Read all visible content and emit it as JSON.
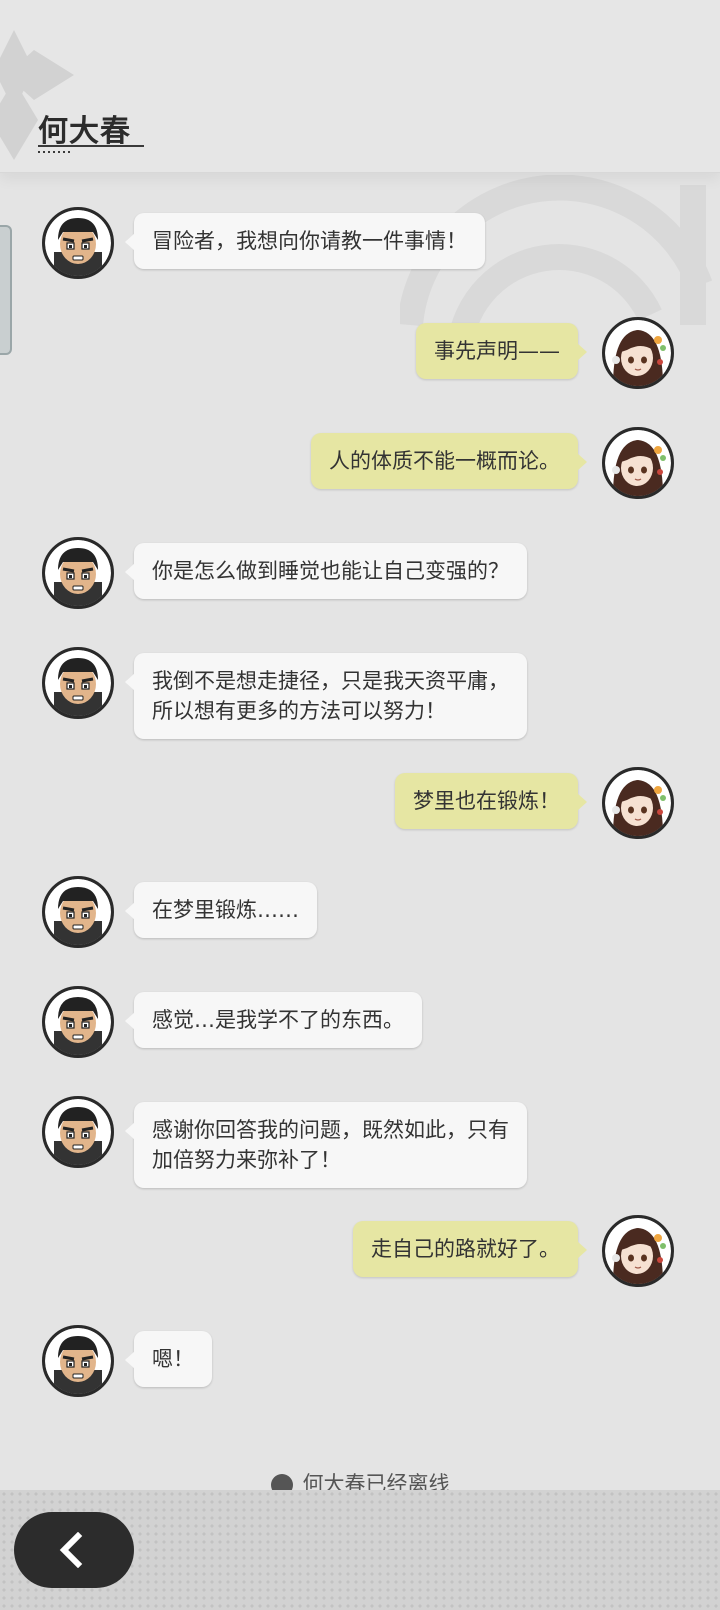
{
  "header": {
    "title": "何大春"
  },
  "messages": [
    {
      "speaker": "npc",
      "text": "冒险者，我想向你请教一件事情！"
    },
    {
      "speaker": "player",
      "text": "事先声明——"
    },
    {
      "speaker": "player",
      "text": "人的体质不能一概而论。"
    },
    {
      "speaker": "npc",
      "text": "你是怎么做到睡觉也能让自己变强的？"
    },
    {
      "speaker": "npc",
      "text": "我倒不是想走捷径，只是我天资平庸，\n所以想有更多的方法可以努力！"
    },
    {
      "speaker": "player",
      "text": "梦里也在锻炼！"
    },
    {
      "speaker": "npc",
      "text": "在梦里锻炼……"
    },
    {
      "speaker": "npc",
      "text": "感觉…是我学不了的东西。"
    },
    {
      "speaker": "npc",
      "text": "感谢你回答我的问题，既然如此，只有\n加倍努力来弥补了！"
    },
    {
      "speaker": "player",
      "text": "走自己的路就好了。"
    },
    {
      "speaker": "npc",
      "text": "嗯！"
    }
  ],
  "status": {
    "text": "何大春已经离线"
  },
  "footer": {
    "back_icon": "chevron-left-icon"
  }
}
